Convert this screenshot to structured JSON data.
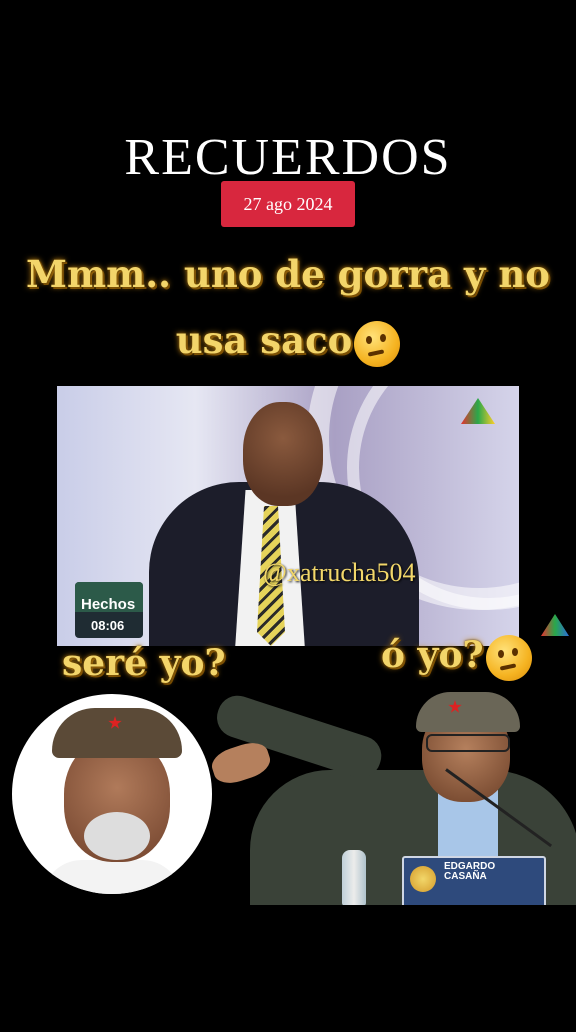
{
  "header": {
    "title": "RECUERDOS",
    "date": "27 ago 2024"
  },
  "captions": {
    "top_line1": "Mmm.. uno de gorra y no",
    "top_line2": "usa saco",
    "left": "seré yo?",
    "right": "ó yo?",
    "emoji": "thinking-face-icon"
  },
  "video": {
    "watermark": "@xatrucha504",
    "program_label": "Hechos",
    "program_time": "08:06"
  },
  "nameplate": {
    "name": "EDGARDO CASAÑA"
  },
  "colors": {
    "background": "#000000",
    "badge": "#d8273e",
    "caption": "#f3d56a"
  }
}
